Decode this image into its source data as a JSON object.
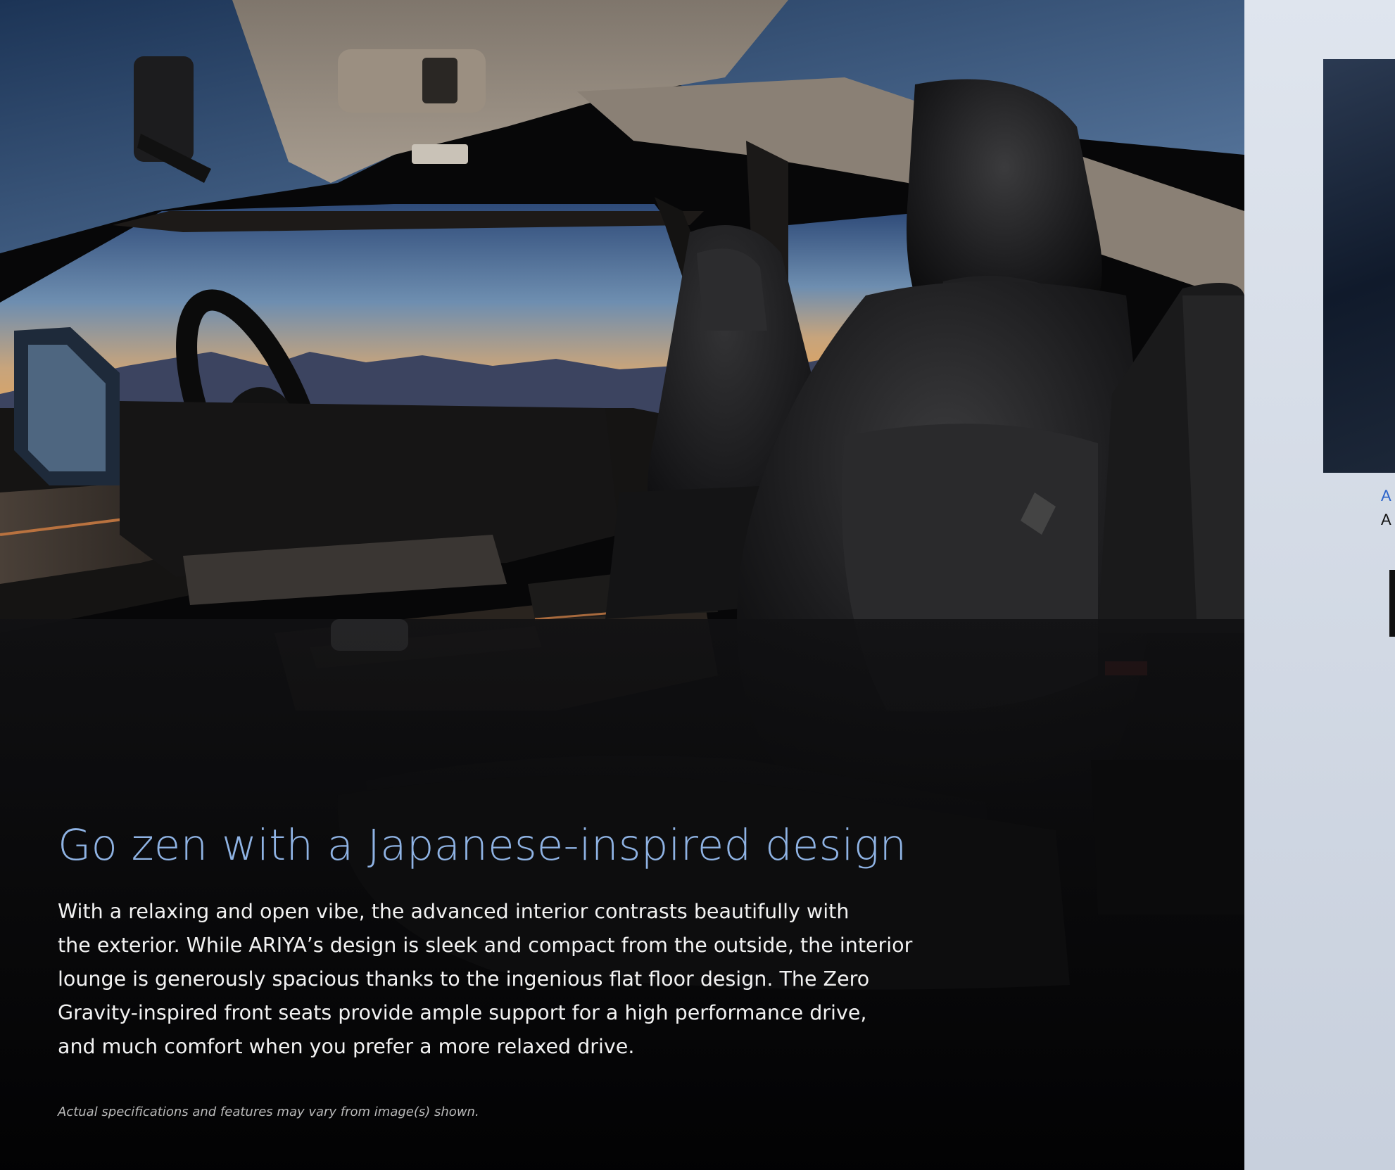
{
  "article": {
    "headline": "Go zen with a Japanese-inspired design",
    "body_lines": [
      "With a relaxing and open vibe, the advanced interior contrasts beautifully with",
      "the exterior. While ARIYA’s design is sleek and compact from the outside, the interior",
      "lounge is generously spacious thanks to the ingenious flat floor design. The Zero",
      "Gravity-inspired front seats provide ample support for a high performance drive,",
      "and much comfort when you prefer a more relaxed drive."
    ],
    "disclaimer": "Actual specifications and features may vary from image(s) shown."
  },
  "side_page": {
    "caption_1": "A",
    "caption_2": "A"
  },
  "colors": {
    "headline": "#8fb3e4",
    "body_text": "#f2f2f2",
    "disclaimer": "#b9b9b9",
    "side_caption_accent": "#2a62c9"
  }
}
